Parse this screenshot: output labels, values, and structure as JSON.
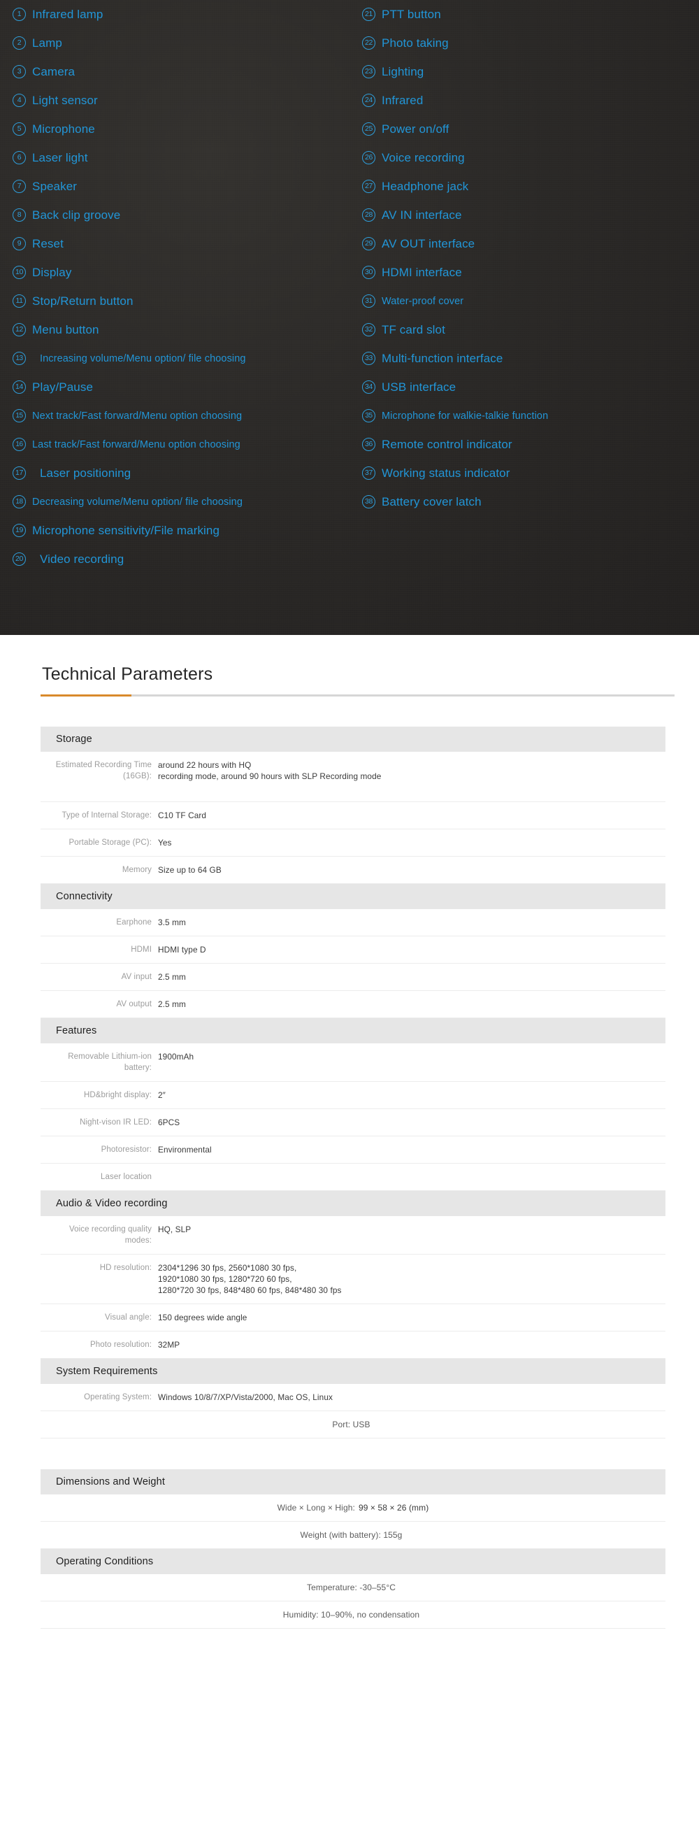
{
  "callouts": {
    "left": [
      {
        "num": "1",
        "label": "Infrared lamp",
        "small": false,
        "indent": false
      },
      {
        "num": "2",
        "label": "Lamp",
        "small": false,
        "indent": false
      },
      {
        "num": "3",
        "label": "Camera",
        "small": false,
        "indent": false
      },
      {
        "num": "4",
        "label": "Light sensor",
        "small": false,
        "indent": false
      },
      {
        "num": "5",
        "label": "Microphone",
        "small": false,
        "indent": false
      },
      {
        "num": "6",
        "label": "Laser light",
        "small": false,
        "indent": false
      },
      {
        "num": "7",
        "label": "Speaker",
        "small": false,
        "indent": false
      },
      {
        "num": "8",
        "label": "Back clip groove",
        "small": false,
        "indent": false
      },
      {
        "num": "9",
        "label": "Reset",
        "small": false,
        "indent": false
      },
      {
        "num": "10",
        "label": "Display",
        "small": false,
        "indent": false
      },
      {
        "num": "11",
        "label": "Stop/Return button",
        "small": false,
        "indent": false
      },
      {
        "num": "12",
        "label": "Menu button",
        "small": false,
        "indent": false
      },
      {
        "num": "13",
        "label": "Increasing volume/Menu option/ file choosing",
        "small": true,
        "indent": true
      },
      {
        "num": "14",
        "label": "Play/Pause",
        "small": false,
        "indent": false
      },
      {
        "num": "15",
        "label": "Next track/Fast forward/Menu option choosing",
        "small": true,
        "indent": false
      },
      {
        "num": "16",
        "label": "Last track/Fast forward/Menu option choosing",
        "small": true,
        "indent": false
      },
      {
        "num": "17",
        "label": "Laser positioning",
        "small": false,
        "indent": true
      },
      {
        "num": "18",
        "label": "Decreasing volume/Menu option/ file choosing",
        "small": true,
        "indent": false
      },
      {
        "num": "19",
        "label": "Microphone sensitivity/File marking",
        "small": false,
        "indent": false
      },
      {
        "num": "20",
        "label": "Video recording",
        "small": false,
        "indent": true
      }
    ],
    "right": [
      {
        "num": "21",
        "label": "PTT button",
        "small": false,
        "indent": false
      },
      {
        "num": "22",
        "label": "Photo taking",
        "small": false,
        "indent": false
      },
      {
        "num": "23",
        "label": "Lighting",
        "small": false,
        "indent": false
      },
      {
        "num": "24",
        "label": "Infrared",
        "small": false,
        "indent": false
      },
      {
        "num": "25",
        "label": "Power on/off",
        "small": false,
        "indent": false
      },
      {
        "num": "26",
        "label": "Voice recording",
        "small": false,
        "indent": false
      },
      {
        "num": "27",
        "label": "Headphone jack",
        "small": false,
        "indent": false
      },
      {
        "num": "28",
        "label": "AV IN interface",
        "small": false,
        "indent": false
      },
      {
        "num": "29",
        "label": "AV OUT interface",
        "small": false,
        "indent": false
      },
      {
        "num": "30",
        "label": "HDMI interface",
        "small": false,
        "indent": false
      },
      {
        "num": "31",
        "label": "Water-proof cover",
        "small": true,
        "indent": false
      },
      {
        "num": "32",
        "label": "TF card slot",
        "small": false,
        "indent": false
      },
      {
        "num": "33",
        "label": "Multi-function interface",
        "small": false,
        "indent": false
      },
      {
        "num": "34",
        "label": "USB interface",
        "small": false,
        "indent": false
      },
      {
        "num": "35",
        "label": "Microphone for walkie-talkie function",
        "small": true,
        "indent": false
      },
      {
        "num": "36",
        "label": "Remote control indicator",
        "small": false,
        "indent": false
      },
      {
        "num": "37",
        "label": "Working status indicator",
        "small": false,
        "indent": false
      },
      {
        "num": "38",
        "label": "Battery cover latch",
        "small": false,
        "indent": false
      }
    ]
  },
  "tech": {
    "title": "Technical Parameters",
    "accent_color": "#d98a2b",
    "sections": [
      {
        "heading": "Storage",
        "rows": [
          {
            "key": "Estimated Recording Time (16GB):",
            "value": "around 22 hours with HQ\nrecording mode, around 90 hours with SLP Recording mode",
            "tall": true
          },
          {
            "key": "Type of Internal Storage:",
            "value": "C10 TF Card"
          },
          {
            "key": "Portable Storage (PC):",
            "value": "Yes"
          },
          {
            "key": "Memory",
            "value": "Size up to 64 GB"
          }
        ]
      },
      {
        "heading": "Connectivity",
        "rows": [
          {
            "key": "Earphone",
            "value": "3.5 mm"
          },
          {
            "key": "HDMI",
            "value": "HDMI type D"
          },
          {
            "key": "AV input",
            "value": "2.5 mm"
          },
          {
            "key": "AV output",
            "value": "2.5 mm"
          }
        ]
      },
      {
        "heading": "Features",
        "rows": [
          {
            "key": "Removable Lithium-ion battery:",
            "value": "1900mAh"
          },
          {
            "key": "HD&bright display:",
            "value": "2″"
          },
          {
            "key": "Night-vison IR LED:",
            "value": "6PCS"
          },
          {
            "key": "Photoresistor:",
            "value": "Environmental"
          },
          {
            "key": "Laser location",
            "value": ""
          }
        ]
      },
      {
        "heading": "Audio & Video recording",
        "rows": [
          {
            "key": "Voice recording quality modes:",
            "value": "HQ, SLP"
          },
          {
            "key": "HD resolution:",
            "value": "2304*1296 30 fps, 2560*1080 30 fps,\n1920*1080 30 fps, 1280*720 60 fps,\n1280*720 30 fps, 848*480 60 fps, 848*480 30 fps"
          },
          {
            "key": "Visual angle:",
            "value": "150 degrees wide angle"
          },
          {
            "key": "Photo resolution:",
            "value": "32MP"
          }
        ]
      },
      {
        "heading": "System Requirements",
        "rows": [
          {
            "key": "Operating System:",
            "value": "Windows 10/8/7/XP/Vista/2000, Mac OS, Linux"
          },
          {
            "key": "Port: USB",
            "value": "",
            "centered": true
          }
        ],
        "spacer_after": true
      },
      {
        "heading": "Dimensions and Weight",
        "rows": [
          {
            "key": "Wide × Long × High:",
            "value": "99 × 58 × 26 (mm)",
            "centered": true
          },
          {
            "key": "Weight (with battery): 155g",
            "value": "",
            "centered": true
          }
        ]
      },
      {
        "heading": "Operating Conditions",
        "rows": [
          {
            "key": "Temperature: -30–55°C",
            "value": "",
            "centered": true
          },
          {
            "key": "Humidity: 10–90%, no condensation",
            "value": "",
            "centered": true
          }
        ]
      }
    ]
  }
}
